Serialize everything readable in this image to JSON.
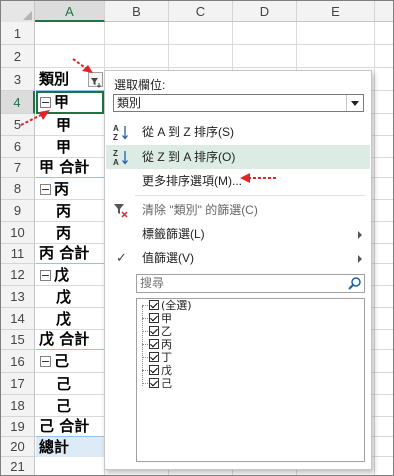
{
  "columns": [
    "A",
    "B",
    "C",
    "D",
    "E"
  ],
  "selected_column": "A",
  "rows": [
    "1",
    "2",
    "3",
    "4",
    "5",
    "6",
    "7",
    "8",
    "9",
    "10",
    "11",
    "12",
    "13",
    "14",
    "15",
    "16",
    "17",
    "18",
    "19",
    "20",
    "21"
  ],
  "selected_row": "4",
  "cells": {
    "a3": "類別",
    "a4": "甲",
    "a5": "甲",
    "a6": "甲",
    "a7": "甲 合計",
    "a8": "丙",
    "a9": "丙",
    "a10": "丙",
    "a11": "丙 合計",
    "a12": "戊",
    "a13": "戊",
    "a14": "戊",
    "a15": "戊 合計",
    "a16": "己",
    "a17": "己",
    "a18": "己",
    "a19": "己 合計",
    "a20": "總計"
  },
  "menu": {
    "select_field_label": "選取欄位:",
    "selected_field": "類別",
    "sort_az": "從 A 到 Z 排序(S)",
    "sort_za": "從 Z 到 A 排序(O)",
    "more_sort": "更多排序選項(M)...",
    "clear_filter": "清除 \"類別\" 的篩選(C)",
    "label_filter": "標籤篩選(L)",
    "value_filter": "值篩選(V)",
    "search_placeholder": "搜尋",
    "list": [
      "(全選)",
      "甲",
      "乙",
      "丙",
      "丁",
      "戊",
      "己"
    ]
  },
  "colors": {
    "accent_green": "#217346",
    "highlight": "#dcece4",
    "annotation_red": "#e0252a",
    "grand_total_fill": "#ddebf7"
  },
  "icons": [
    "filter-icon",
    "sort-az-icon",
    "sort-za-icon",
    "clear-filter-icon",
    "checkmark-icon",
    "search-icon",
    "chevron-down-icon",
    "collapse-icon"
  ]
}
